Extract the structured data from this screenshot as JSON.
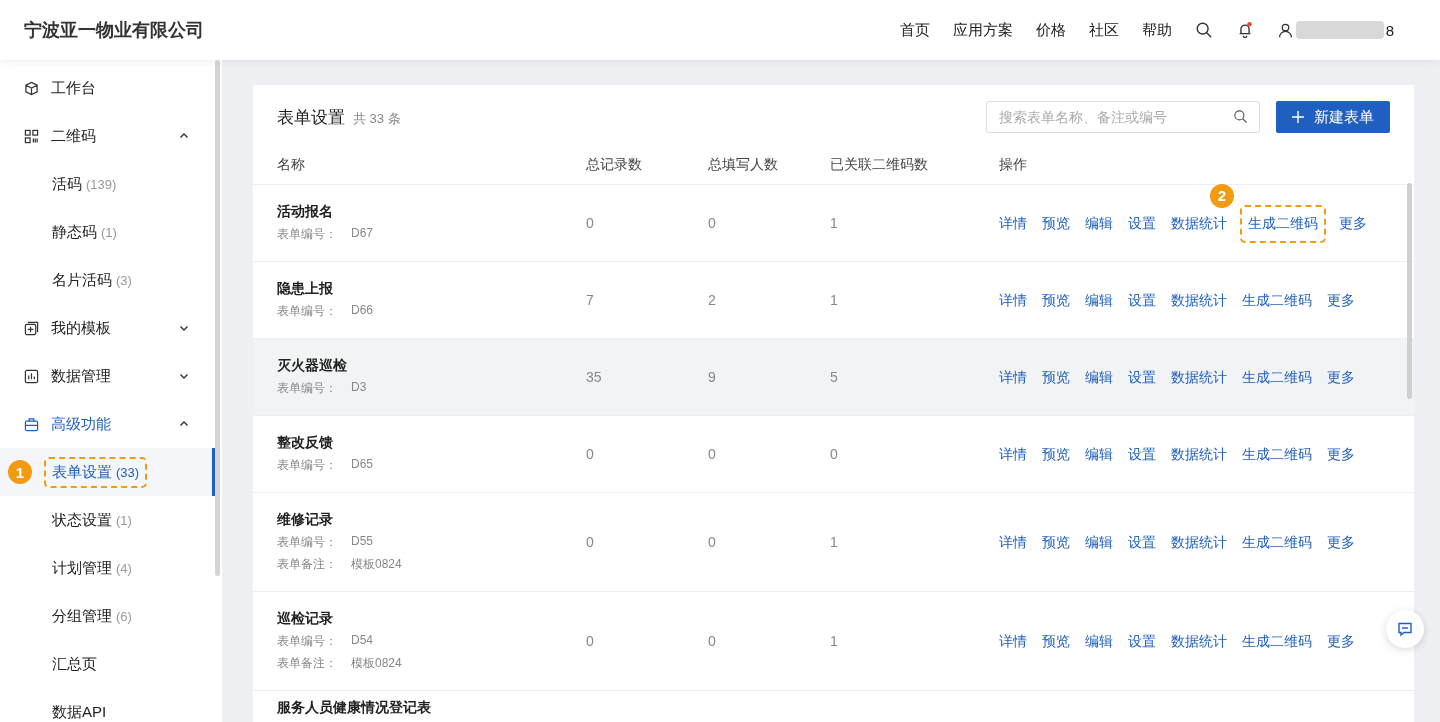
{
  "header": {
    "company": "宁波亚一物业有限公司",
    "nav": [
      "首页",
      "应用方案",
      "价格",
      "社区",
      "帮助"
    ],
    "notification_dot": true,
    "user": "8"
  },
  "sidebar": {
    "items": [
      {
        "label": "工作台"
      },
      {
        "label": "二维码",
        "expanded": true,
        "children": [
          {
            "label": "活码",
            "count": "(139)",
            "selected": false
          },
          {
            "label": "静态码",
            "count": "(1)",
            "selected": false
          },
          {
            "label": "名片活码",
            "count": "(3)",
            "selected": false
          }
        ]
      },
      {
        "label": "我的模板",
        "expanded": false
      },
      {
        "label": "数据管理",
        "expanded": false
      },
      {
        "label": "高级功能",
        "expanded": true,
        "children": [
          {
            "label": "表单设置",
            "count": "(33)",
            "selected": true,
            "callout": "1"
          },
          {
            "label": "状态设置",
            "count": "(1)",
            "selected": false
          },
          {
            "label": "计划管理",
            "count": "(4)",
            "selected": false
          },
          {
            "label": "分组管理",
            "count": "(6)",
            "selected": false
          },
          {
            "label": "汇总页",
            "selected": false
          },
          {
            "label": "数据API",
            "selected": false
          }
        ]
      }
    ]
  },
  "panel": {
    "title": "表单设置",
    "total": "共 33 条",
    "search": {
      "placeholder": "搜索表单名称、备注或编号"
    },
    "new_button": "新建表单",
    "columns": [
      "名称",
      "总记录数",
      "总填写人数",
      "已关联二维码数",
      "操作"
    ],
    "rows": [
      {
        "name": "活动报名",
        "code_label": "表单编号：",
        "code": "D67",
        "records": "0",
        "fillers": "0",
        "linked": "1",
        "highlighted": false,
        "actions": [
          {
            "label": "详情"
          },
          {
            "label": "预览"
          },
          {
            "label": "编辑"
          },
          {
            "label": "设置"
          },
          {
            "label": "数据统计"
          },
          {
            "label": "生成二维码",
            "callout": "2"
          },
          {
            "label": "更多"
          }
        ]
      },
      {
        "name": "隐患上报",
        "code_label": "表单编号：",
        "code": "D66",
        "records": "7",
        "fillers": "2",
        "linked": "1",
        "highlighted": false,
        "actions": [
          {
            "label": "详情"
          },
          {
            "label": "预览"
          },
          {
            "label": "编辑"
          },
          {
            "label": "设置"
          },
          {
            "label": "数据统计"
          },
          {
            "label": "生成二维码"
          },
          {
            "label": "更多"
          }
        ]
      },
      {
        "name": "灭火器巡检",
        "code_label": "表单编号：",
        "code": "D3",
        "records": "35",
        "fillers": "9",
        "linked": "5",
        "highlighted": true,
        "actions": [
          {
            "label": "详情"
          },
          {
            "label": "预览"
          },
          {
            "label": "编辑"
          },
          {
            "label": "设置"
          },
          {
            "label": "数据统计"
          },
          {
            "label": "生成二维码"
          },
          {
            "label": "更多"
          }
        ]
      },
      {
        "name": "整改反馈",
        "code_label": "表单编号：",
        "code": "D65",
        "records": "0",
        "fillers": "0",
        "linked": "0",
        "highlighted": false,
        "actions": [
          {
            "label": "详情"
          },
          {
            "label": "预览"
          },
          {
            "label": "编辑"
          },
          {
            "label": "设置"
          },
          {
            "label": "数据统计"
          },
          {
            "label": "生成二维码"
          },
          {
            "label": "更多"
          }
        ]
      },
      {
        "name": "维修记录",
        "code_label": "表单编号：",
        "code": "D55",
        "remark_label": "表单备注：",
        "remark": "模板0824",
        "records": "0",
        "fillers": "0",
        "linked": "1",
        "highlighted": false,
        "actions": [
          {
            "label": "详情"
          },
          {
            "label": "预览"
          },
          {
            "label": "编辑"
          },
          {
            "label": "设置"
          },
          {
            "label": "数据统计"
          },
          {
            "label": "生成二维码"
          },
          {
            "label": "更多"
          }
        ]
      },
      {
        "name": "巡检记录",
        "code_label": "表单编号：",
        "code": "D54",
        "remark_label": "表单备注：",
        "remark": "模板0824",
        "records": "0",
        "fillers": "0",
        "linked": "1",
        "highlighted": false,
        "actions": [
          {
            "label": "详情"
          },
          {
            "label": "预览"
          },
          {
            "label": "编辑"
          },
          {
            "label": "设置"
          },
          {
            "label": "数据统计"
          },
          {
            "label": "生成二维码"
          },
          {
            "label": "更多"
          }
        ]
      },
      {
        "name": "服务人员健康情况登记表",
        "highlighted": false
      }
    ]
  }
}
